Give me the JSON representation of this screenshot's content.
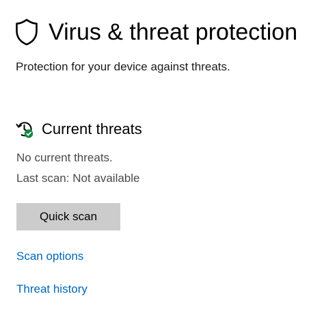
{
  "header": {
    "title": "Virus & threat protection",
    "subtitle": "Protection for your device against threats.",
    "icon": "shield-icon"
  },
  "current_threats": {
    "heading": "Current threats",
    "icon": "threat-status-icon",
    "status": "No current threats.",
    "last_scan": "Last scan: Not available",
    "quick_scan_label": "Quick scan"
  },
  "links": {
    "scan_options": "Scan options",
    "threat_history": "Threat history"
  },
  "colors": {
    "link": "#0067b8",
    "button_bg": "#cccccc",
    "status_ok": "#10893e"
  }
}
